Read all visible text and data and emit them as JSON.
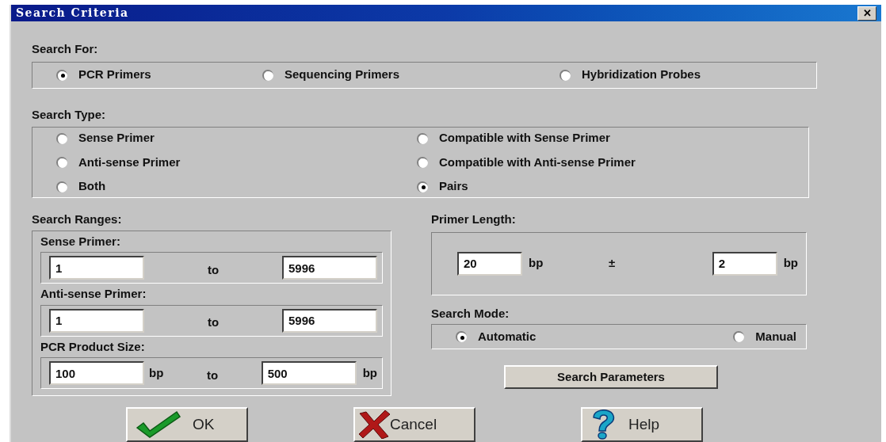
{
  "window": {
    "title": "Search Criteria",
    "close": "✕"
  },
  "search_for": {
    "label": "Search For:",
    "options": [
      {
        "label": "PCR Primers",
        "selected": true
      },
      {
        "label": "Sequencing Primers",
        "selected": false
      },
      {
        "label": "Hybridization Probes",
        "selected": false
      }
    ]
  },
  "search_type": {
    "label": "Search Type:",
    "options": [
      {
        "label": "Sense Primer",
        "selected": false
      },
      {
        "label": "Compatible with Sense Primer",
        "selected": false
      },
      {
        "label": "Anti-sense Primer",
        "selected": false
      },
      {
        "label": "Compatible with Anti-sense Primer",
        "selected": false
      },
      {
        "label": "Both",
        "selected": false
      },
      {
        "label": "Pairs",
        "selected": true
      }
    ]
  },
  "search_ranges": {
    "label": "Search Ranges:",
    "groups": [
      {
        "label": "Sense Primer:",
        "from": {
          "value": "1"
        },
        "joiner": "to",
        "to": {
          "value": "5996"
        }
      },
      {
        "label": "Anti-sense Primer:",
        "from": {
          "value": "1"
        },
        "joiner": "to",
        "to": {
          "value": "5996"
        }
      },
      {
        "label": "PCR Product Size:",
        "from": {
          "value": "100",
          "unit": "bp"
        },
        "joiner": "to",
        "to": {
          "value": "500",
          "unit": "bp"
        }
      }
    ]
  },
  "primer_length": {
    "label": "Primer Length:",
    "value": "20",
    "unit": "bp",
    "symbol": "±",
    "tolerance": "2",
    "tolerance_unit": "bp"
  },
  "search_mode": {
    "label": "Search Mode:",
    "options": [
      {
        "label": "Automatic",
        "selected": true
      },
      {
        "label": "Manual",
        "selected": false
      }
    ]
  },
  "parameters_button": "Search Parameters",
  "buttons": [
    {
      "kind": "ok",
      "label": "OK"
    },
    {
      "kind": "cancel",
      "label": "Cancel"
    },
    {
      "kind": "help",
      "label": "Help"
    }
  ]
}
